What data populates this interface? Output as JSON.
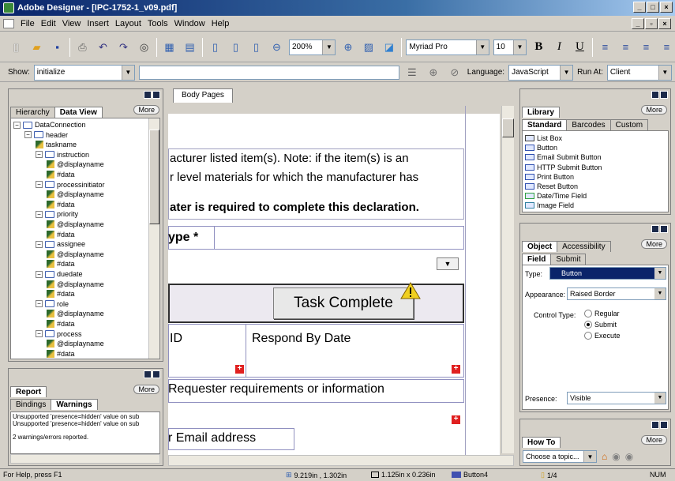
{
  "window": {
    "title": "Adobe Designer - [IPC-1752-1_v09.pdf]"
  },
  "menu": [
    "File",
    "Edit",
    "View",
    "Insert",
    "Layout",
    "Tools",
    "Window",
    "Help"
  ],
  "toolbar": {
    "zoom": "200%",
    "font": "Myriad Pro",
    "font_size": "10",
    "bold": "B",
    "italic": "I",
    "underline": "U"
  },
  "script_bar": {
    "show_label": "Show:",
    "show_value": "initialize",
    "language_label": "Language:",
    "language_value": "JavaScript",
    "runat_label": "Run At:",
    "runat_value": "Client"
  },
  "left_panel": {
    "tabs": [
      "Hierarchy",
      "Data View"
    ],
    "more": "More",
    "tree": [
      {
        "label": "DataConnection",
        "level": 0,
        "type": "root"
      },
      {
        "label": "header",
        "level": 1,
        "type": "folder"
      },
      {
        "label": "taskname",
        "level": 2,
        "type": "leaf"
      },
      {
        "label": "instruction",
        "level": 2,
        "type": "folder"
      },
      {
        "label": "@displayname",
        "level": 3,
        "type": "leaf"
      },
      {
        "label": "#data",
        "level": 3,
        "type": "leaf"
      },
      {
        "label": "processinitiator",
        "level": 2,
        "type": "folder"
      },
      {
        "label": "@displayname",
        "level": 3,
        "type": "leaf"
      },
      {
        "label": "#data",
        "level": 3,
        "type": "leaf"
      },
      {
        "label": "priority",
        "level": 2,
        "type": "folder"
      },
      {
        "label": "@displayname",
        "level": 3,
        "type": "leaf"
      },
      {
        "label": "#data",
        "level": 3,
        "type": "leaf"
      },
      {
        "label": "assignee",
        "level": 2,
        "type": "folder"
      },
      {
        "label": "@displayname",
        "level": 3,
        "type": "leaf"
      },
      {
        "label": "#data",
        "level": 3,
        "type": "leaf"
      },
      {
        "label": "duedate",
        "level": 2,
        "type": "folder"
      },
      {
        "label": "@displayname",
        "level": 3,
        "type": "leaf"
      },
      {
        "label": "#data",
        "level": 3,
        "type": "leaf"
      },
      {
        "label": "role",
        "level": 2,
        "type": "folder"
      },
      {
        "label": "@displayname",
        "level": 3,
        "type": "leaf"
      },
      {
        "label": "#data",
        "level": 3,
        "type": "leaf"
      },
      {
        "label": "process",
        "level": 2,
        "type": "folder"
      },
      {
        "label": "@displayname",
        "level": 3,
        "type": "leaf"
      },
      {
        "label": "#data",
        "level": 3,
        "type": "leaf"
      }
    ]
  },
  "report_panel": {
    "title": "Report",
    "more": "More",
    "tabs": [
      "Bindings",
      "Warnings"
    ],
    "lines": [
      "Unsupported 'presence=hidden' value on sub",
      "Unsupported 'presence=hidden' value on sub",
      "",
      "2 warnings/errors reported."
    ]
  },
  "body_tab": "Body Pages",
  "form": {
    "line1": "acturer listed item(s). Note: if the item(s) is an",
    "line2": "r level materials for which the manufacturer has",
    "line3": "ater is required to complete this declaration.",
    "type_label": "ype *",
    "button_caption": "Task Complete",
    "id_label": "ID",
    "respond_label": "Respond By Date",
    "requester_label": "Requester requirements or information",
    "email_label": "r Email address"
  },
  "library_panel": {
    "title": "Library",
    "more": "More",
    "tabs": [
      "Standard",
      "Barcodes",
      "Custom"
    ],
    "items": [
      "List Box",
      "Button",
      "Email Submit Button",
      "HTTP Submit Button",
      "Print Button",
      "Reset Button",
      "Date/Time Field",
      "Image Field"
    ]
  },
  "object_panel": {
    "tabs": [
      "Object",
      "Accessibility"
    ],
    "more": "More",
    "subtabs": [
      "Field",
      "Submit"
    ],
    "type_label": "Type:",
    "type_value": "Button",
    "appearance_label": "Appearance:",
    "appearance_value": "Raised Border",
    "control_type_label": "Control Type:",
    "control_options": [
      "Regular",
      "Submit",
      "Execute"
    ],
    "control_selected": "Submit",
    "presence_label": "Presence:",
    "presence_value": "Visible"
  },
  "howto_panel": {
    "title": "How To",
    "more": "More",
    "topic": "Choose a topic..."
  },
  "status": {
    "help": "For Help, press F1",
    "position": "9.219in , 1.302in",
    "size": "1.125in x 0.236in",
    "object": "Button4",
    "page": "1/4",
    "mode": "NUM"
  }
}
